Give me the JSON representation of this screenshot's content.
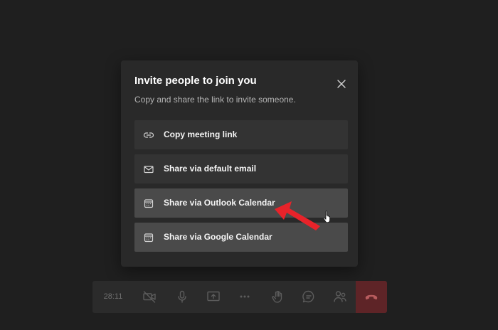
{
  "dialog": {
    "title": "Invite people to join you",
    "subtitle": "Copy and share the link to invite someone.",
    "options": [
      {
        "label": "Copy meeting link",
        "icon": "link-icon"
      },
      {
        "label": "Share via default email",
        "icon": "mail-icon"
      },
      {
        "label": "Share via Outlook Calendar",
        "icon": "calendar-icon"
      },
      {
        "label": "Share via Google Calendar",
        "icon": "calendar-icon"
      }
    ]
  },
  "call_bar": {
    "timer": "28:11",
    "buttons": [
      "video-off-icon",
      "microphone-icon",
      "share-screen-icon",
      "more-options-icon",
      "raise-hand-icon",
      "chat-icon",
      "participants-icon",
      "hang-up-icon"
    ]
  },
  "colors": {
    "background": "#1f1f1f",
    "dialog_background": "#292929",
    "option_background": "#333333",
    "option_highlight": "#4a4a4a",
    "hangup": "#5e2427",
    "annotation_arrow": "#e8232a"
  }
}
